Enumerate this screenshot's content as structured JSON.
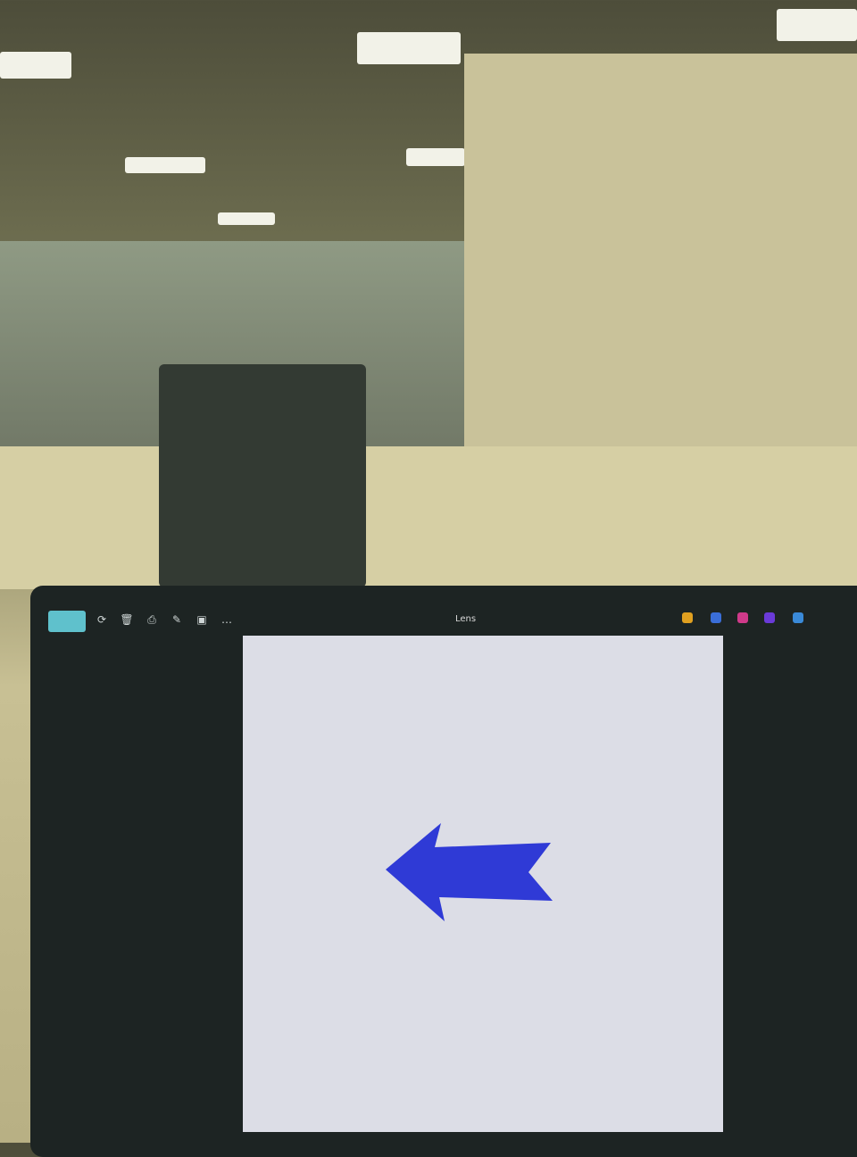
{
  "app": {
    "title": "Lens",
    "toolbar_icons": [
      "home-icon",
      "rotate-icon",
      "delete-icon",
      "print-icon",
      "edit-icon",
      "crop-icon",
      "more-icon"
    ],
    "swatch_colors": [
      "#e0a020",
      "#3a6ed8",
      "#d03a8a",
      "#6a3ad8",
      "#3a8ad8"
    ]
  },
  "canvas": {
    "shape": "arrow-left",
    "arrow_color": "#2f3ad6",
    "background_color": "#dcdde6"
  }
}
